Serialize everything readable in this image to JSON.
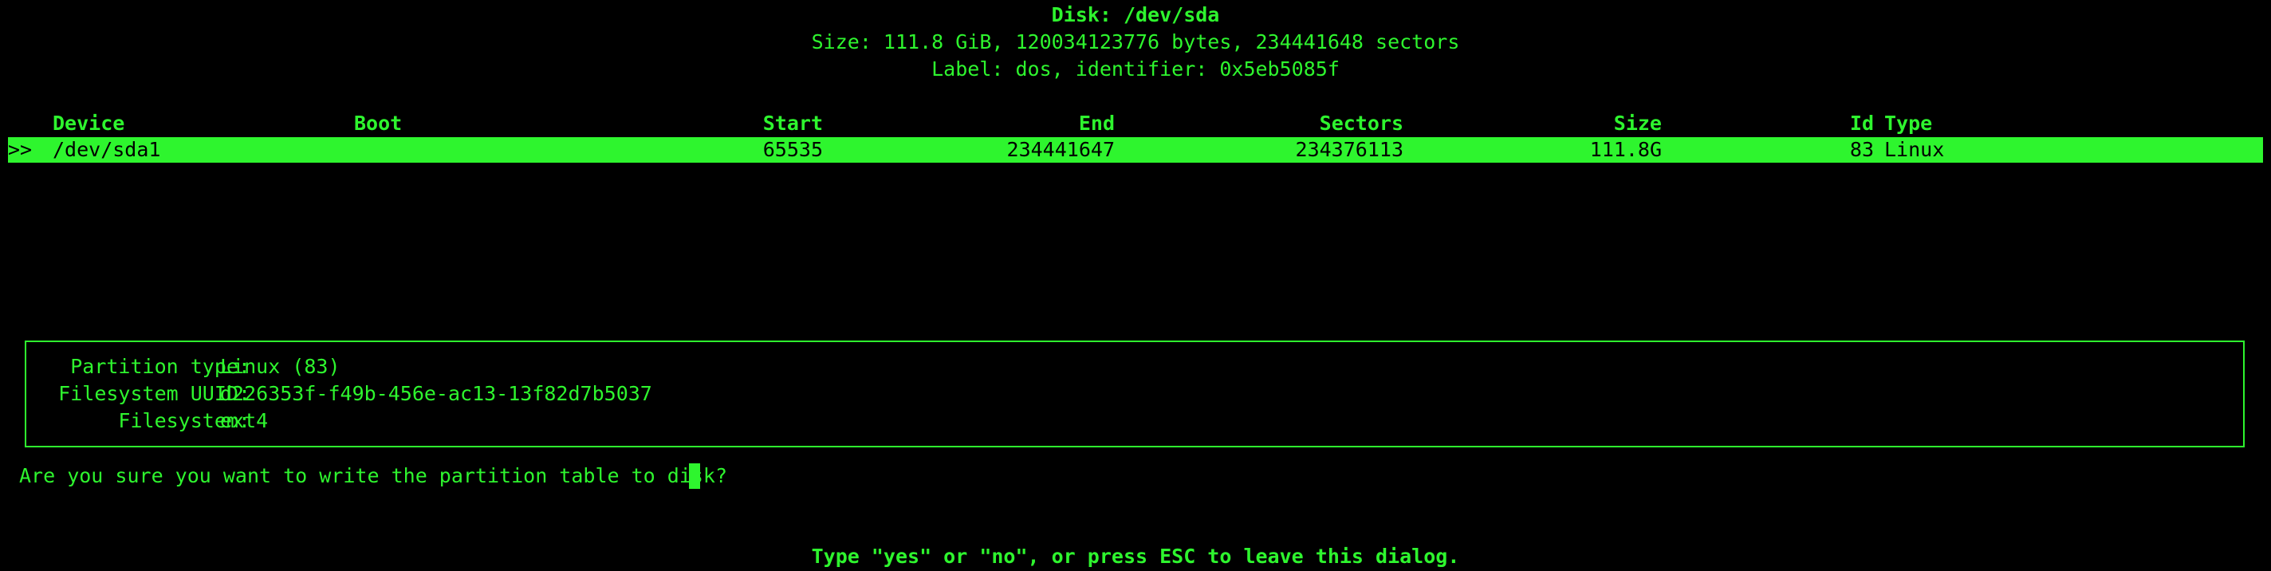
{
  "header": {
    "disk": "Disk: /dev/sda",
    "size": "Size: 111.8 GiB, 120034123776 bytes, 234441648 sectors",
    "label": "Label: dos, identifier: 0x5eb5085f"
  },
  "table": {
    "columns": {
      "device": "Device",
      "boot": "Boot",
      "start": "Start",
      "end": "End",
      "sectors": "Sectors",
      "size": "Size",
      "id": "Id",
      "type": "Type"
    },
    "rows": [
      {
        "marker": ">>",
        "device": "/dev/sda1",
        "boot": "",
        "start": "65535",
        "end": "234441647",
        "sectors": "234376113",
        "size": "111.8G",
        "id": "83",
        "type": "Linux"
      }
    ]
  },
  "info": {
    "partition_type_label": "Partition type:",
    "partition_type_value": "Linux (83)",
    "uuid_label": "Filesystem UUID:",
    "uuid_value": "d226353f-f49b-456e-ac13-13f82d7b5037",
    "filesystem_label": "Filesystem:",
    "filesystem_value": "ext4"
  },
  "prompt": {
    "question": "Are you sure you want to write the partition table to disk?",
    "input_value": ""
  },
  "footer": {
    "hint": "Type \"yes\" or \"no\", or press ESC to leave this dialog."
  },
  "colors": {
    "foreground": "#2ef52e",
    "background": "#000000",
    "selection": "#2ef52e"
  }
}
